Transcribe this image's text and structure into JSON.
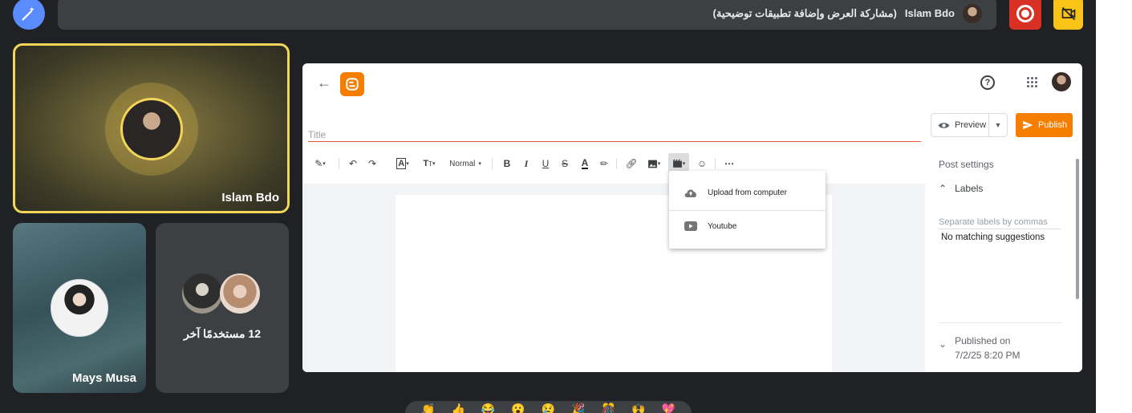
{
  "banner": {
    "presenter": "Islam Bdo",
    "subtitle": "(مشاركة العرض وإضافة تطبيقات توضيحية)"
  },
  "tiles": {
    "main_name": "Islam Bdo",
    "second_name": "Mays Musa",
    "others_label": "12 مستخدمًا آخر"
  },
  "blogger": {
    "title_placeholder": "Title",
    "preview_label": "Preview",
    "publish_label": "Publish",
    "toolbar": {
      "paragraph_style": "Normal"
    },
    "video_menu": {
      "items": [
        {
          "label": "Upload from computer",
          "icon": "cloud-upload-icon"
        },
        {
          "label": "Youtube",
          "icon": "youtube-icon"
        }
      ]
    },
    "sidebar": {
      "title": "Post settings",
      "labels_header": "Labels",
      "labels_placeholder": "Separate labels by commas",
      "no_match": "No matching suggestions",
      "published_on_label": "Published on",
      "published_on_value": "7/2/25 8:20 PM"
    }
  },
  "colors": {
    "meet_bg": "#202124",
    "banner_bg": "#3c4043",
    "record_red": "#d93025",
    "cam_yellow": "#f9c416",
    "active_speaker": "#f2d65a",
    "blogger_orange": "#f57d00"
  }
}
